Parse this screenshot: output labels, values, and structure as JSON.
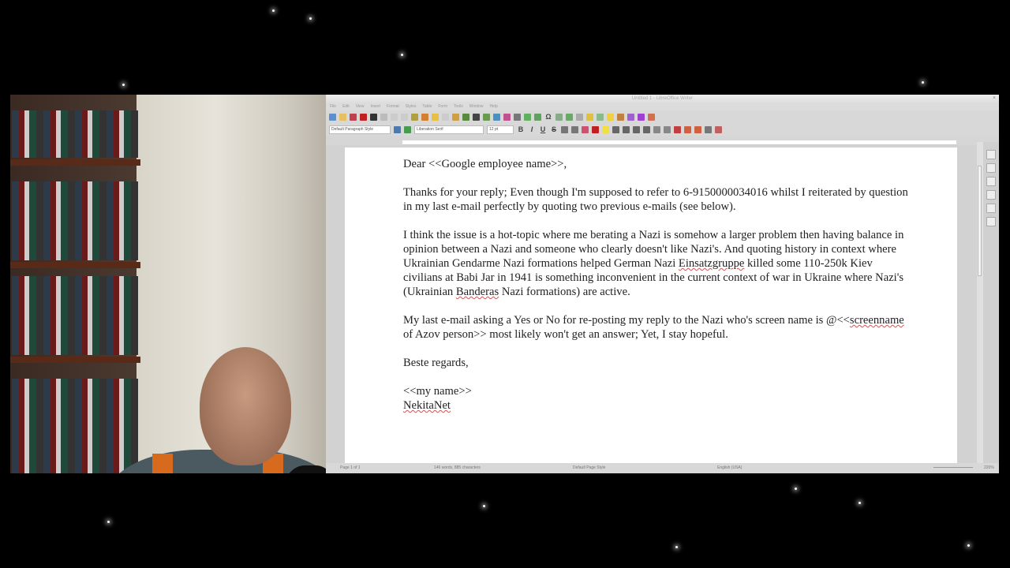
{
  "window": {
    "title": "Untitled 1 - LibreOffice Writer",
    "close": "×"
  },
  "menu": [
    "File",
    "Edit",
    "View",
    "Insert",
    "Format",
    "Styles",
    "Table",
    "Form",
    "Tools",
    "Window",
    "Help"
  ],
  "toolbar": {
    "paragraph_style": "Default Paragraph Style",
    "font_name": "Liberation Serif",
    "font_size": "12 pt",
    "bold": "B",
    "italic": "I",
    "underline": "U",
    "strike": "S",
    "special_char": "Ω"
  },
  "document": {
    "greeting": "Dear <<Google employee name>>,",
    "para1": "Thanks for your reply; Even though I'm supposed to refer to 6-9150000034016 whilst I reiterated by question in my last e-mail perfectly by quoting two previous e-mails (see below).",
    "para2a": "I think the issue is a hot-topic where me berating a Nazi is somehow a larger problem then having balance in opinion between a Nazi and someone who clearly doesn't like Nazi's. And quoting history in context where Ukrainian Gendarme Nazi formations helped German Nazi ",
    "para2_sp1": "Einsatzgruppe",
    "para2b": " killed some 110-250k Kiev civilians at Babi Jar in 1941 is something inconvenient in the current context of war in Ukraine where Nazi's (Ukrainian ",
    "para2_sp2": "Banderas",
    "para2c": " Nazi formations) are active.",
    "para3a": "My last e-mail asking a Yes or No for re-posting my reply to the Nazi who's screen name is @<<",
    "para3_sp": "screenname",
    "para3b": " of Azov person>> most likely won't get an answer; Yet, I stay hopeful.",
    "closing": "Beste regards,",
    "sig1": "<<my name>>",
    "sig2": "NekitaNet"
  },
  "status": {
    "page": "Page 1 of 1",
    "words": "146 words, 885 characters",
    "page_style": "Default Page Style",
    "language": "English (USA)",
    "zoom": "220%"
  }
}
